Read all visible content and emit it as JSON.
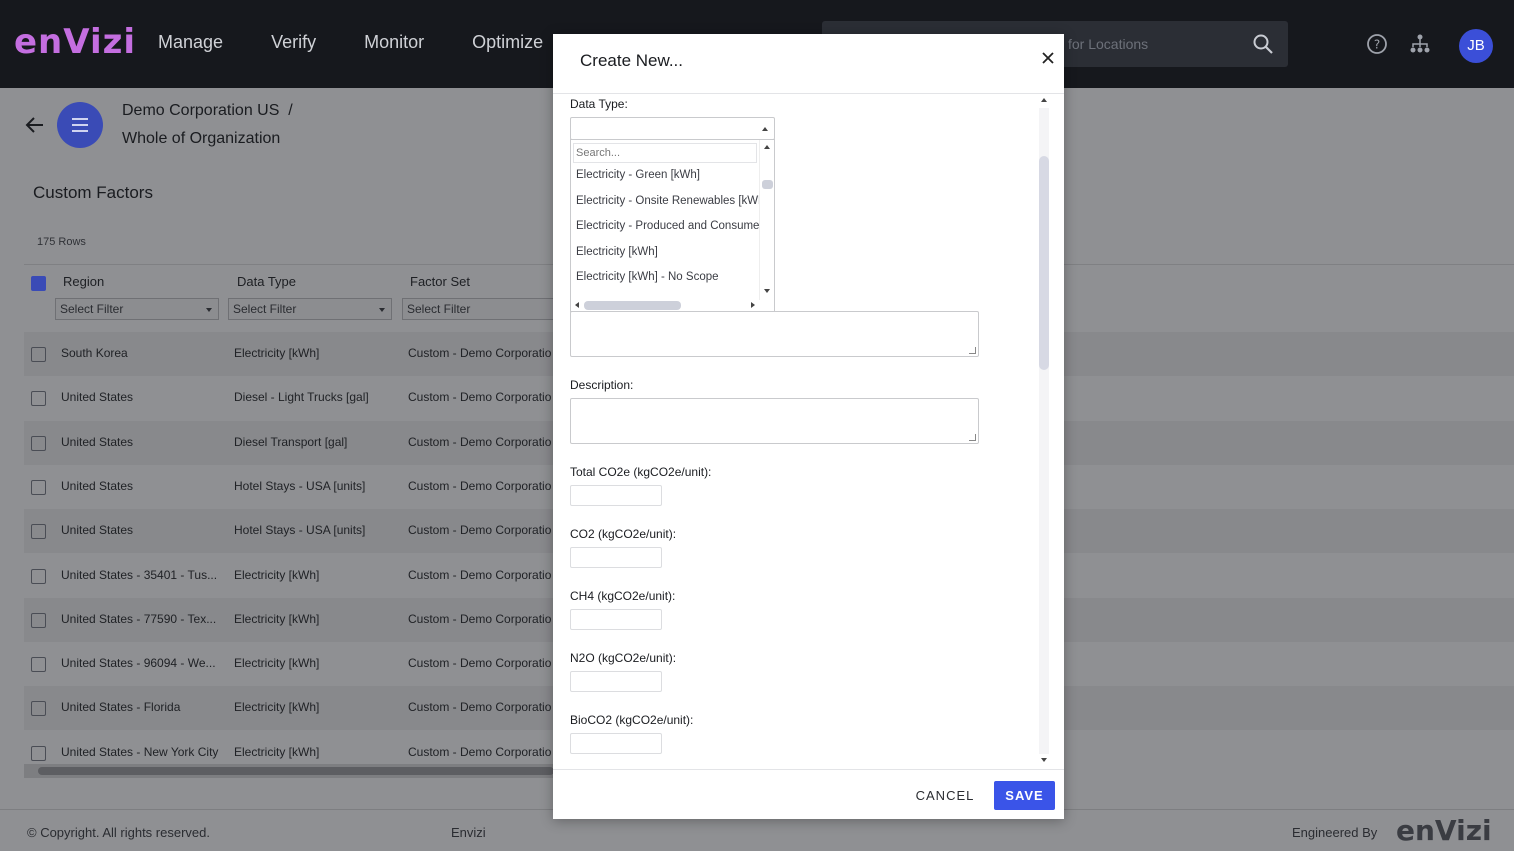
{
  "app": {
    "logo": "enVizi",
    "nav": [
      "Manage",
      "Verify",
      "Monitor",
      "Optimize"
    ],
    "search_placeholder": "for Locations",
    "avatar_initials": "JB"
  },
  "breadcrumb": {
    "org": "Demo Corporation US",
    "separator": "/",
    "scope": "Whole of Organization"
  },
  "page": {
    "title": "Custom Factors",
    "row_count": "175 Rows"
  },
  "grid": {
    "columns": [
      "Region",
      "Data Type",
      "Factor Set"
    ],
    "filter_placeholder": "Select Filter",
    "rows": [
      {
        "region": "South Korea",
        "data_type": "Electricity [kWh]",
        "factor_set": "Custom - Demo Corporatio"
      },
      {
        "region": "United States",
        "data_type": "Diesel - Light Trucks [gal]",
        "factor_set": "Custom - Demo Corporatio"
      },
      {
        "region": "United States",
        "data_type": "Diesel Transport [gal]",
        "factor_set": "Custom - Demo Corporatio"
      },
      {
        "region": "United States",
        "data_type": "Hotel Stays - USA [units]",
        "factor_set": "Custom - Demo Corporatio"
      },
      {
        "region": "United States",
        "data_type": "Hotel Stays - USA [units]",
        "factor_set": "Custom - Demo Corporatio"
      },
      {
        "region": "United States - 35401 - Tus...",
        "data_type": "Electricity [kWh]",
        "factor_set": "Custom - Demo Corporatio"
      },
      {
        "region": "United States - 77590 - Tex...",
        "data_type": "Electricity [kWh]",
        "factor_set": "Custom - Demo Corporatio"
      },
      {
        "region": "United States - 96094 - We...",
        "data_type": "Electricity [kWh]",
        "factor_set": "Custom - Demo Corporatio"
      },
      {
        "region": "United States - Florida",
        "data_type": "Electricity [kWh]",
        "factor_set": "Custom - Demo Corporatio"
      },
      {
        "region": "United States - New York City",
        "data_type": "Electricity [kWh]",
        "factor_set": "Custom - Demo Corporatio"
      }
    ]
  },
  "footer": {
    "copyright": "© Copyright. All rights reserved.",
    "center": "Envizi",
    "engineered_by": "Engineered By",
    "logo": "enVizi"
  },
  "modal": {
    "title": "Create New...",
    "data_type_label": "Data Type:",
    "dropdown": {
      "search_placeholder": "Search...",
      "options": [
        "Electricity - Green [kWh]",
        "Electricity - Onsite Renewables [kWh]",
        "Electricity - Produced and Consumed",
        "Electricity [kWh]",
        "Electricity [kWh] - No Scope"
      ]
    },
    "description_label": "Description:",
    "fields": [
      "Total CO2e (kgCO2e/unit):",
      "CO2 (kgCO2e/unit):",
      "CH4 (kgCO2e/unit):",
      "N2O (kgCO2e/unit):",
      "BioCO2 (kgCO2e/unit):"
    ],
    "cancel_label": "CANCEL",
    "save_label": "SAVE"
  }
}
